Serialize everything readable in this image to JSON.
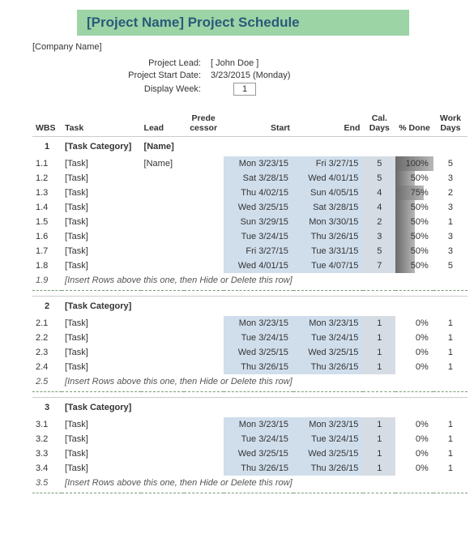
{
  "title": "[Project Name] Project Schedule",
  "company": "[Company Name]",
  "meta": {
    "lead_label": "Project Lead:",
    "lead_value": "[ John Doe ]",
    "start_label": "Project Start Date:",
    "start_value": "3/23/2015 (Monday)",
    "display_label": "Display Week:",
    "display_value": "1"
  },
  "headers": {
    "wbs": "WBS",
    "task": "Task",
    "lead": "Lead",
    "pred": "Prede cessor",
    "start": "Start",
    "end": "End",
    "days": "Cal. Days",
    "done": "% Done",
    "work": "Work Days"
  },
  "sections": [
    {
      "wbs": "1",
      "category": "[Task Category]",
      "lead": "[Name]",
      "rows": [
        {
          "wbs": "1.1",
          "task": "[Task]",
          "lead": "[Name]",
          "start": "Mon 3/23/15",
          "end": "Fri 3/27/15",
          "days": "5",
          "done": "100%",
          "done_pct": 100,
          "work": "5"
        },
        {
          "wbs": "1.2",
          "task": "[Task]",
          "lead": "",
          "start": "Sat 3/28/15",
          "end": "Wed 4/01/15",
          "days": "5",
          "done": "50%",
          "done_pct": 50,
          "work": "3"
        },
        {
          "wbs": "1.3",
          "task": "[Task]",
          "lead": "",
          "start": "Thu 4/02/15",
          "end": "Sun 4/05/15",
          "days": "4",
          "done": "75%",
          "done_pct": 75,
          "work": "2"
        },
        {
          "wbs": "1.4",
          "task": "[Task]",
          "lead": "",
          "start": "Wed 3/25/15",
          "end": "Sat 3/28/15",
          "days": "4",
          "done": "50%",
          "done_pct": 50,
          "work": "3"
        },
        {
          "wbs": "1.5",
          "task": "[Task]",
          "lead": "",
          "start": "Sun 3/29/15",
          "end": "Mon 3/30/15",
          "days": "2",
          "done": "50%",
          "done_pct": 50,
          "work": "1"
        },
        {
          "wbs": "1.6",
          "task": "[Task]",
          "lead": "",
          "start": "Tue 3/24/15",
          "end": "Thu 3/26/15",
          "days": "3",
          "done": "50%",
          "done_pct": 50,
          "work": "3"
        },
        {
          "wbs": "1.7",
          "task": "[Task]",
          "lead": "",
          "start": "Fri 3/27/15",
          "end": "Tue 3/31/15",
          "days": "5",
          "done": "50%",
          "done_pct": 50,
          "work": "3"
        },
        {
          "wbs": "1.8",
          "task": "[Task]",
          "lead": "",
          "start": "Wed 4/01/15",
          "end": "Tue 4/07/15",
          "days": "7",
          "done": "50%",
          "done_pct": 50,
          "work": "5"
        }
      ],
      "insert_wbs": "1.9",
      "insert_text": "[Insert Rows above this one, then Hide or Delete this row]"
    },
    {
      "wbs": "2",
      "category": "[Task Category]",
      "lead": "",
      "rows": [
        {
          "wbs": "2.1",
          "task": "[Task]",
          "lead": "",
          "start": "Mon 3/23/15",
          "end": "Mon 3/23/15",
          "days": "1",
          "done": "0%",
          "done_pct": 0,
          "work": "1"
        },
        {
          "wbs": "2.2",
          "task": "[Task]",
          "lead": "",
          "start": "Tue 3/24/15",
          "end": "Tue 3/24/15",
          "days": "1",
          "done": "0%",
          "done_pct": 0,
          "work": "1"
        },
        {
          "wbs": "2.3",
          "task": "[Task]",
          "lead": "",
          "start": "Wed 3/25/15",
          "end": "Wed 3/25/15",
          "days": "1",
          "done": "0%",
          "done_pct": 0,
          "work": "1"
        },
        {
          "wbs": "2.4",
          "task": "[Task]",
          "lead": "",
          "start": "Thu 3/26/15",
          "end": "Thu 3/26/15",
          "days": "1",
          "done": "0%",
          "done_pct": 0,
          "work": "1"
        }
      ],
      "insert_wbs": "2.5",
      "insert_text": "[Insert Rows above this one, then Hide or Delete this row]"
    },
    {
      "wbs": "3",
      "category": "[Task Category]",
      "lead": "",
      "rows": [
        {
          "wbs": "3.1",
          "task": "[Task]",
          "lead": "",
          "start": "Mon 3/23/15",
          "end": "Mon 3/23/15",
          "days": "1",
          "done": "0%",
          "done_pct": 0,
          "work": "1"
        },
        {
          "wbs": "3.2",
          "task": "[Task]",
          "lead": "",
          "start": "Tue 3/24/15",
          "end": "Tue 3/24/15",
          "days": "1",
          "done": "0%",
          "done_pct": 0,
          "work": "1"
        },
        {
          "wbs": "3.3",
          "task": "[Task]",
          "lead": "",
          "start": "Wed 3/25/15",
          "end": "Wed 3/25/15",
          "days": "1",
          "done": "0%",
          "done_pct": 0,
          "work": "1"
        },
        {
          "wbs": "3.4",
          "task": "[Task]",
          "lead": "",
          "start": "Thu 3/26/15",
          "end": "Thu 3/26/15",
          "days": "1",
          "done": "0%",
          "done_pct": 0,
          "work": "1"
        }
      ],
      "insert_wbs": "3.5",
      "insert_text": "[Insert Rows above this one, then Hide or Delete this row]"
    }
  ]
}
